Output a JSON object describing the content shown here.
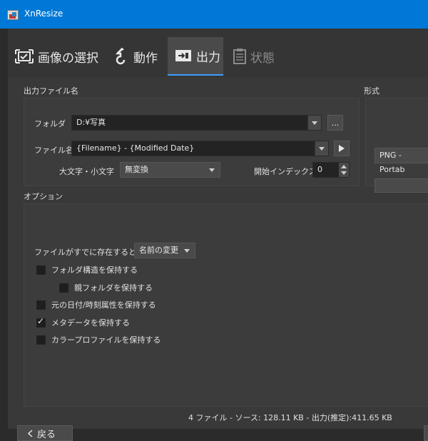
{
  "window": {
    "title": "XnResize",
    "app_icon": "xnresize-icon"
  },
  "tabs": [
    {
      "label": "画像の選択",
      "icon": "image-select-icon",
      "state": "normal"
    },
    {
      "label": "動作",
      "icon": "action-arrow-icon",
      "state": "normal"
    },
    {
      "label": "出力",
      "icon": "output-icon",
      "state": "active"
    },
    {
      "label": "状態",
      "icon": "status-list-icon",
      "state": "disabled"
    }
  ],
  "output_filename": {
    "group_label": "出力ファイル名",
    "folder_label": "フォルダ",
    "folder_value": "D:¥写真",
    "browse_label": "...",
    "filename_label": "ファイル名",
    "filename_value": "{Filename} - {Modified Date}",
    "case_label": "大文字・小文字",
    "case_value": "無変換",
    "start_index_label": "開始インデックス",
    "start_index_value": "0"
  },
  "format": {
    "group_label": "形式",
    "format_value": "PNG - Portab"
  },
  "options": {
    "group_label": "オプション",
    "exists_label": "ファイルがすでに存在するとき",
    "exists_value": "名前の変更",
    "checkboxes": [
      {
        "label": "フォルダ構造を保持する",
        "checked": false
      },
      {
        "label": "親フォルダを保持する",
        "checked": false
      },
      {
        "label": "元の日付/時刻属性を保持する",
        "checked": false
      },
      {
        "label": "メタデータを保持する",
        "checked": true
      },
      {
        "label": "カラープロファイルを保持する",
        "checked": false
      }
    ]
  },
  "footer": {
    "status": "4 ファイル - ソース: 128.11 KB - 出力(推定):411.65 KB",
    "back_label": "戻る"
  },
  "colors": {
    "accent": "#0078d7",
    "tab_underline": "#3aa0ff",
    "background": "#353535"
  }
}
